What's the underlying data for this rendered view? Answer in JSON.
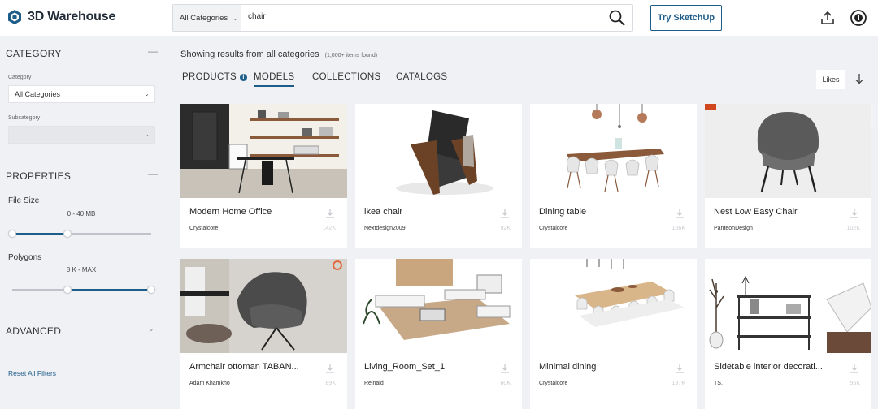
{
  "header": {
    "logo_text": "3D Warehouse",
    "search_category": "All Categories",
    "search_value": "chair",
    "try_button": "Try SketchUp"
  },
  "sidebar": {
    "category_title": "CATEGORY",
    "category_label": "Category",
    "category_value": "All Categories",
    "subcategory_label": "Subcategory",
    "properties_title": "PROPERTIES",
    "file_size_label": "File Size",
    "file_size_range": "0 - 40 MB",
    "file_size_low": 0.0,
    "file_size_high": 0.4,
    "polygons_label": "Polygons",
    "polygons_range": "8 K - MAX",
    "polygons_low": 0.4,
    "polygons_high": 1.0,
    "advanced_title": "ADVANCED",
    "reset_link": "Reset All Filters"
  },
  "main": {
    "results_text": "Showing results from all categories",
    "results_count": "(1,000+ items found)",
    "tabs": [
      "PRODUCTS",
      "MODELS",
      "COLLECTIONS",
      "CATALOGS"
    ],
    "active_tab": "MODELS",
    "sort_label": "Likes"
  },
  "cards": [
    {
      "title": "Modern Home Office",
      "author": "Crystalcore",
      "count": "142K",
      "image": "office-scene"
    },
    {
      "title": "ikea chair",
      "author": "Nextdesign2009",
      "count": "92K",
      "image": "armchair"
    },
    {
      "title": "Dining table",
      "author": "Crystalcore",
      "count": "166K",
      "image": "dining-set"
    },
    {
      "title": "Nest Low Easy Chair",
      "author": "PanteonDesign",
      "count": "102K",
      "image": "grey-chair"
    },
    {
      "title": "Armchair ottoman TABAN...",
      "author": "Adam Khamkho",
      "count": "89K",
      "image": "taban-chair"
    },
    {
      "title": "Living_Room_Set_1",
      "author": "Reinald",
      "count": "60K",
      "image": "living-room"
    },
    {
      "title": "Minimal dining",
      "author": "Crystalcore",
      "count": "137K",
      "image": "minimal-dining"
    },
    {
      "title": "Sidetable interior decorati...",
      "author": "TS.",
      "count": "56K",
      "image": "sidetable"
    }
  ],
  "colors": {
    "accent": "#1e5c8a",
    "background": "#f0f1f4"
  }
}
